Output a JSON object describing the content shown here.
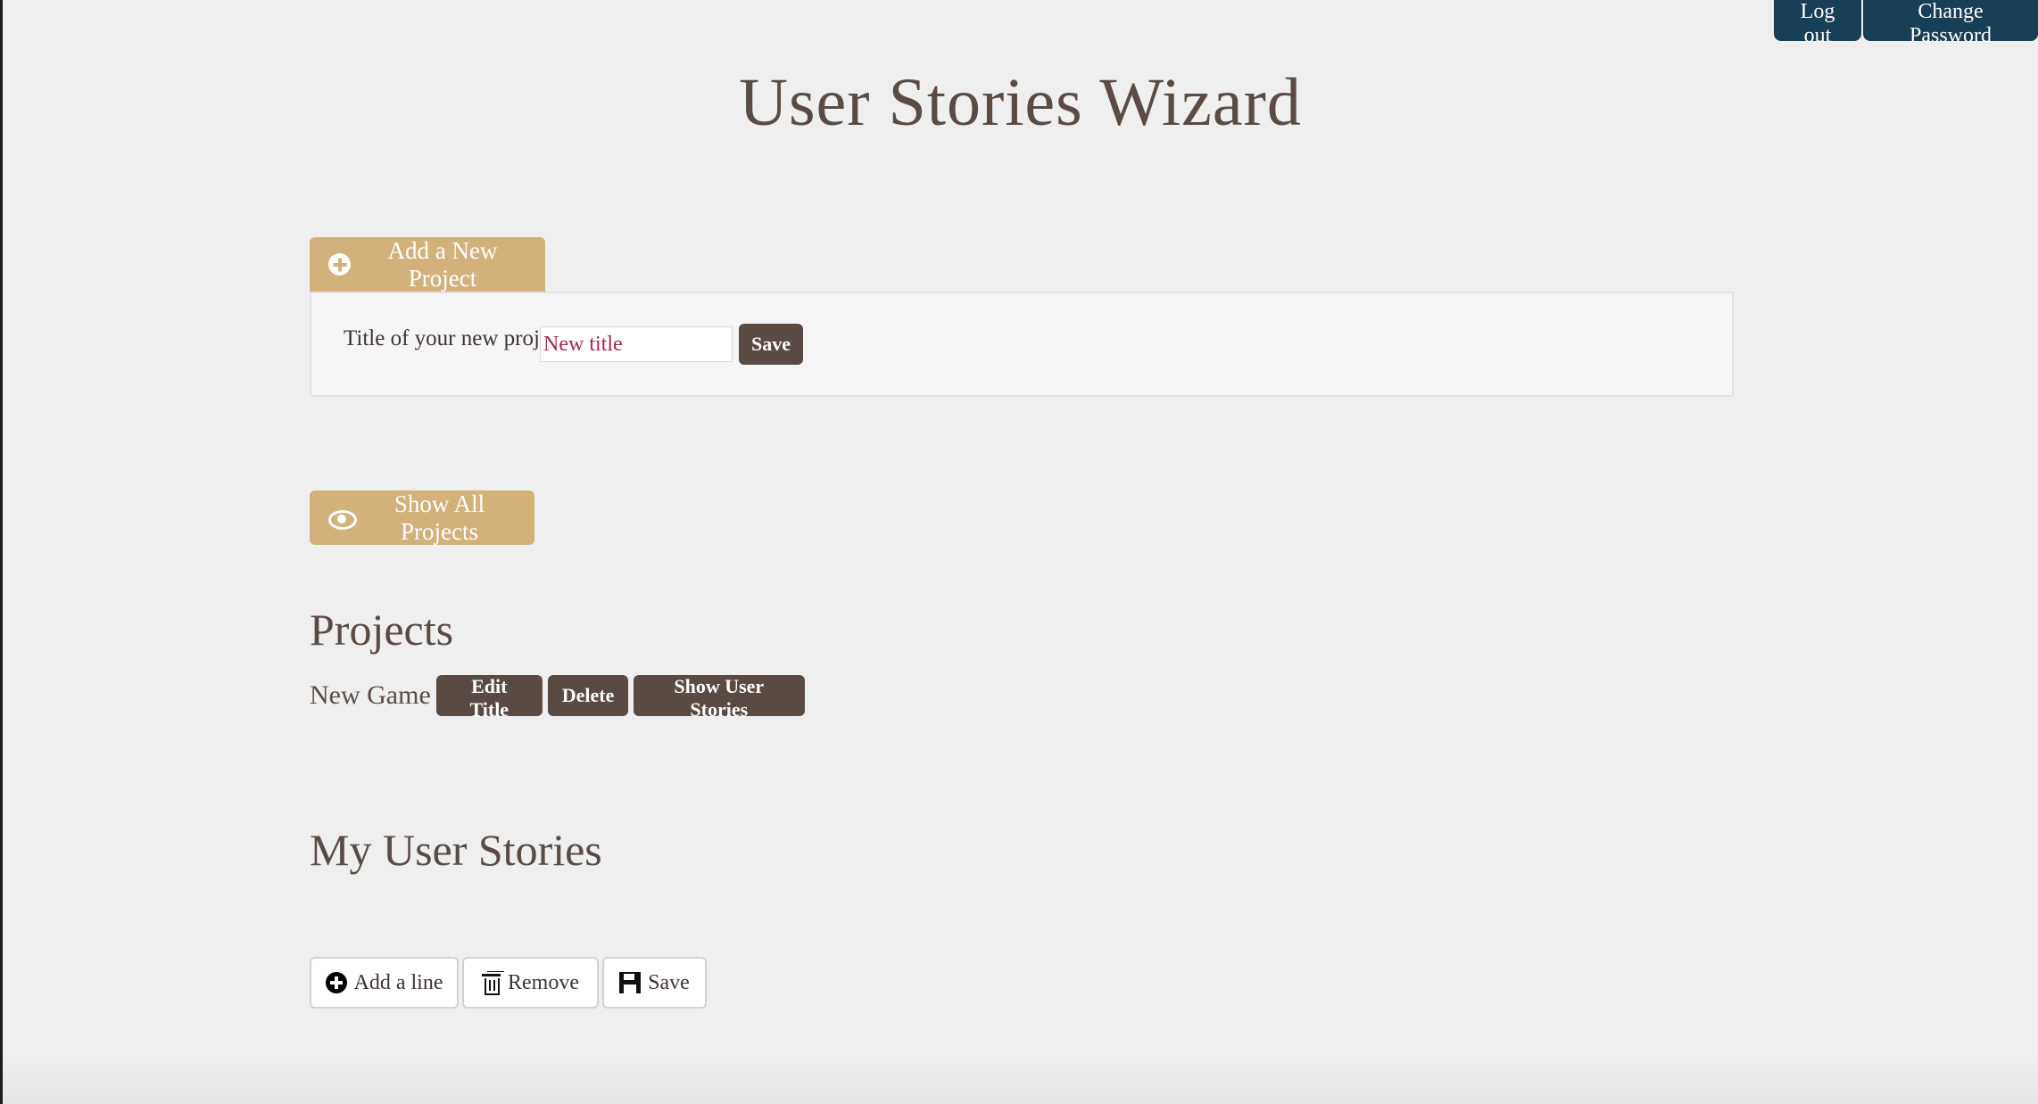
{
  "header": {
    "logout_label": "Log out",
    "change_password_label": "Change Password",
    "title": "User Stories Wizard"
  },
  "new_project": {
    "button_label": "Add a New Project",
    "button_icon": "plus-circle-icon",
    "field_label": "Title of your new project",
    "input_value": "New title",
    "save_label": "Save"
  },
  "projects_controls": {
    "show_all_label": "Show All Projects",
    "show_all_icon": "eye-icon"
  },
  "projects": {
    "heading": "Projects",
    "items": [
      {
        "name": "New Game",
        "edit_label": "Edit Title",
        "delete_label": "Delete",
        "show_stories_label": "Show User Stories"
      }
    ]
  },
  "user_stories": {
    "heading": "My User Stories",
    "toolbar": {
      "add_line_label": "Add a line",
      "add_line_icon": "plus-circle-icon",
      "remove_label": "Remove",
      "remove_icon": "trash-icon",
      "save_label": "Save",
      "save_icon": "floppy-disk-icon"
    }
  },
  "colors": {
    "page_background": "#efefef",
    "primary_text": "#5a4b44",
    "top_nav": "#173f55",
    "tan_button": "#d2b17a",
    "dark_button": "#594a43",
    "input_text": "#a12b48"
  }
}
